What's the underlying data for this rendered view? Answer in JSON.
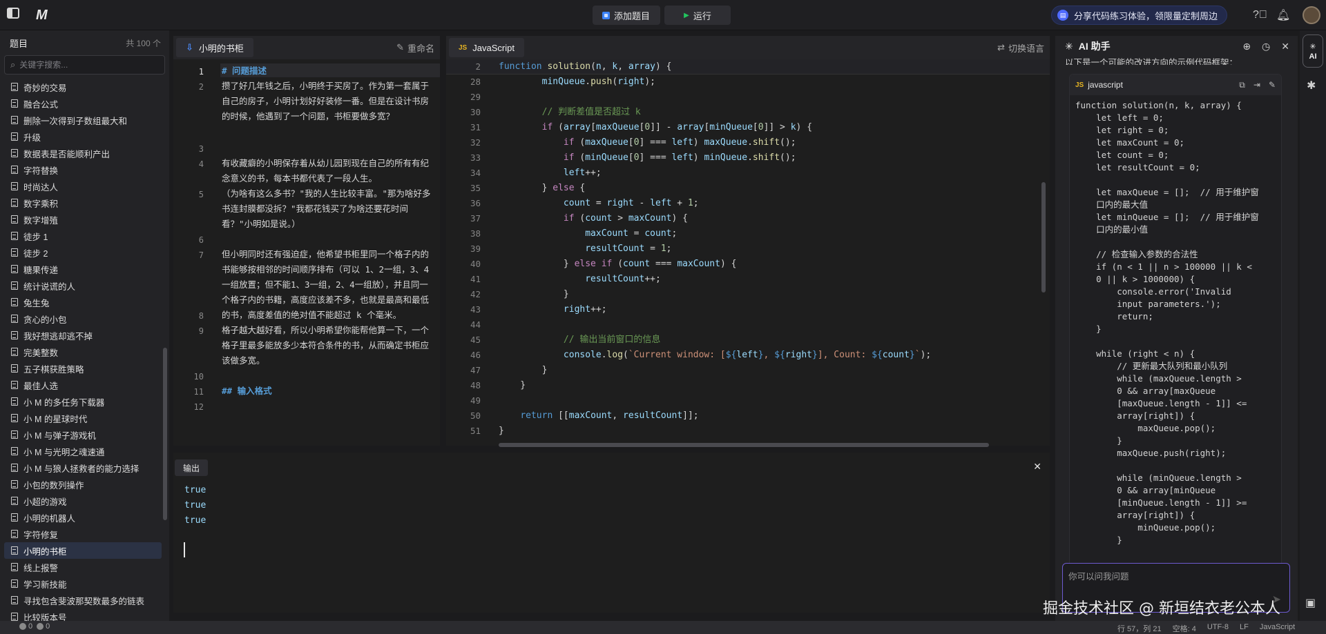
{
  "topbar": {
    "add_problem": "添加题目",
    "run": "运行",
    "promo": "分享代码练习体验，领限量定制周边"
  },
  "sidebar": {
    "title": "题目",
    "count": "共 100 个",
    "search_placeholder": "关键字搜索...",
    "items": [
      "奇妙的交易",
      "融合公式",
      "删除一次得到子数组最大和",
      "升级",
      "数据表是否能顺利产出",
      "字符替换",
      "时尚达人",
      "数字乘积",
      "数字增殖",
      "徒步 1",
      "徒步 2",
      "糖果传递",
      "统计说谎的人",
      "兔生兔",
      "贪心的小包",
      "我好想逃却逃不掉",
      "完美整数",
      "五子棋获胜策略",
      "最佳人选",
      "小 M 的多任务下载器",
      "小 M 的星球时代",
      "小 M 与弹子游戏机",
      "小 M 与光明之魂速通",
      "小 M 与狼人拯救者的能力选择",
      "小包的数列操作",
      "小超的游戏",
      "小明的机器人",
      "字符修复",
      "小明的书柜",
      "线上报警",
      "学习新技能",
      "寻找包含斐波那契数最多的链表",
      "比较版本号"
    ],
    "active_index": 28
  },
  "description": {
    "tab_label": "小明的书柜",
    "rename": "重命名",
    "lines": [
      {
        "num": "1",
        "text": "# 问题描述"
      },
      {
        "num": "2",
        "text": "攒了好几年钱之后，小明终于买房了。作为第一套属于自己的房子，小明计划好好装修一番。但是在设计书房的时候，他遇到了一个问题，书柜要做多宽？"
      },
      {
        "num": "3",
        "text": ""
      },
      {
        "num": "4",
        "text": "有收藏癖的小明保存着从幼儿园到现在自己的所有有纪念意义的书，每本书都代表了一段人生。"
      },
      {
        "num": "5",
        "text": "（为啥有这么多书？\"我的人生比较丰富。\"那为啥好多书连封膜都没拆？\"我都花钱买了为啥还要花时间看？\"小明如是说。）"
      },
      {
        "num": "6",
        "text": ""
      },
      {
        "num": "7",
        "text": "但小明同时还有强迫症，他希望书柜里同一个格子内的书能够按相邻的时间顺序排布（可以 1、2一组，3、4一组放置；但不能1、3一组，2、4一组放），并且同一个格子内的书籍，高度应该差不多，也就是最高和最低的书，高度差值的绝对值不能超过 k 个毫米。"
      },
      {
        "num": "8",
        "text": ""
      },
      {
        "num": "9",
        "text": "格子越大越好看，所以小明希望你能帮他算一下，一个格子里最多能放多少本符合条件的书，从而确定书柜应该做多宽。"
      },
      {
        "num": "10",
        "text": ""
      },
      {
        "num": "11",
        "text": "## 输入格式"
      },
      {
        "num": "12",
        "text": ""
      }
    ]
  },
  "editor": {
    "tab_label": "JavaScript",
    "switch_lang": "切换语言",
    "lines": [
      {
        "num": "2",
        "code": "function solution(n, k, array) {"
      },
      {
        "num": "28",
        "code": "        minQueue.push(right);"
      },
      {
        "num": "29",
        "code": ""
      },
      {
        "num": "30",
        "code": "        // 判断差值是否超过 k"
      },
      {
        "num": "31",
        "code": "        if (array[maxQueue[0]] - array[minQueue[0]] > k) {"
      },
      {
        "num": "32",
        "code": "            if (maxQueue[0] === left) maxQueue.shift();"
      },
      {
        "num": "33",
        "code": "            if (minQueue[0] === left) minQueue.shift();"
      },
      {
        "num": "34",
        "code": "            left++;"
      },
      {
        "num": "35",
        "code": "        } else {"
      },
      {
        "num": "36",
        "code": "            count = right - left + 1;"
      },
      {
        "num": "37",
        "code": "            if (count > maxCount) {"
      },
      {
        "num": "38",
        "code": "                maxCount = count;"
      },
      {
        "num": "39",
        "code": "                resultCount = 1;"
      },
      {
        "num": "40",
        "code": "            } else if (count === maxCount) {"
      },
      {
        "num": "41",
        "code": "                resultCount++;"
      },
      {
        "num": "42",
        "code": "            }"
      },
      {
        "num": "43",
        "code": "            right++;"
      },
      {
        "num": "44",
        "code": ""
      },
      {
        "num": "45",
        "code": "            // 输出当前窗口的信息"
      },
      {
        "num": "46",
        "code": "            console.log(`Current window: [${left}, ${right}], Count: ${count}`);"
      },
      {
        "num": "47",
        "code": "        }"
      },
      {
        "num": "48",
        "code": "    }"
      },
      {
        "num": "49",
        "code": ""
      },
      {
        "num": "50",
        "code": "    return [[maxCount, resultCount]];"
      },
      {
        "num": "51",
        "code": "}"
      }
    ]
  },
  "output": {
    "tab_label": "输出",
    "lines": [
      "true",
      "true",
      "true"
    ]
  },
  "ai": {
    "title": "AI 助手",
    "intro": "以下是一个可能的改进方向的示例代码框架：",
    "code_lang": "javascript",
    "code": "function solution(n, k, array) {\n    let left = 0;\n    let right = 0;\n    let maxCount = 0;\n    let count = 0;\n    let resultCount = 0;\n\n    let maxQueue = [];  // 用于维护窗\n    口内的最大值\n    let minQueue = [];  // 用于维护窗\n    口内的最小值\n\n    // 检查输入参数的合法性\n    if (n < 1 || n > 100000 || k <\n    0 || k > 1000000) {\n        console.error('Invalid\n        input parameters.');\n        return;\n    }\n\n    while (right < n) {\n        // 更新最大队列和最小队列\n        while (maxQueue.length >\n        0 && array[maxQueue\n        [maxQueue.length - 1]] <=\n        array[right]) {\n            maxQueue.pop();\n        }\n        maxQueue.push(right);\n\n        while (minQueue.length >\n        0 && array[minQueue\n        [minQueue.length - 1]] >=\n        array[right]) {\n            minQueue.pop();\n        }",
    "input_placeholder": "你可以问我问题",
    "rail_label": "AI"
  },
  "watermark": "掘金技术社区 @ 新垣结衣老公本人",
  "status": {
    "errors": "0",
    "warnings": "0",
    "position": "行 57，列 21",
    "spaces": "空格: 4",
    "encoding": "UTF-8",
    "eol": "LF",
    "language": "JavaScript"
  }
}
